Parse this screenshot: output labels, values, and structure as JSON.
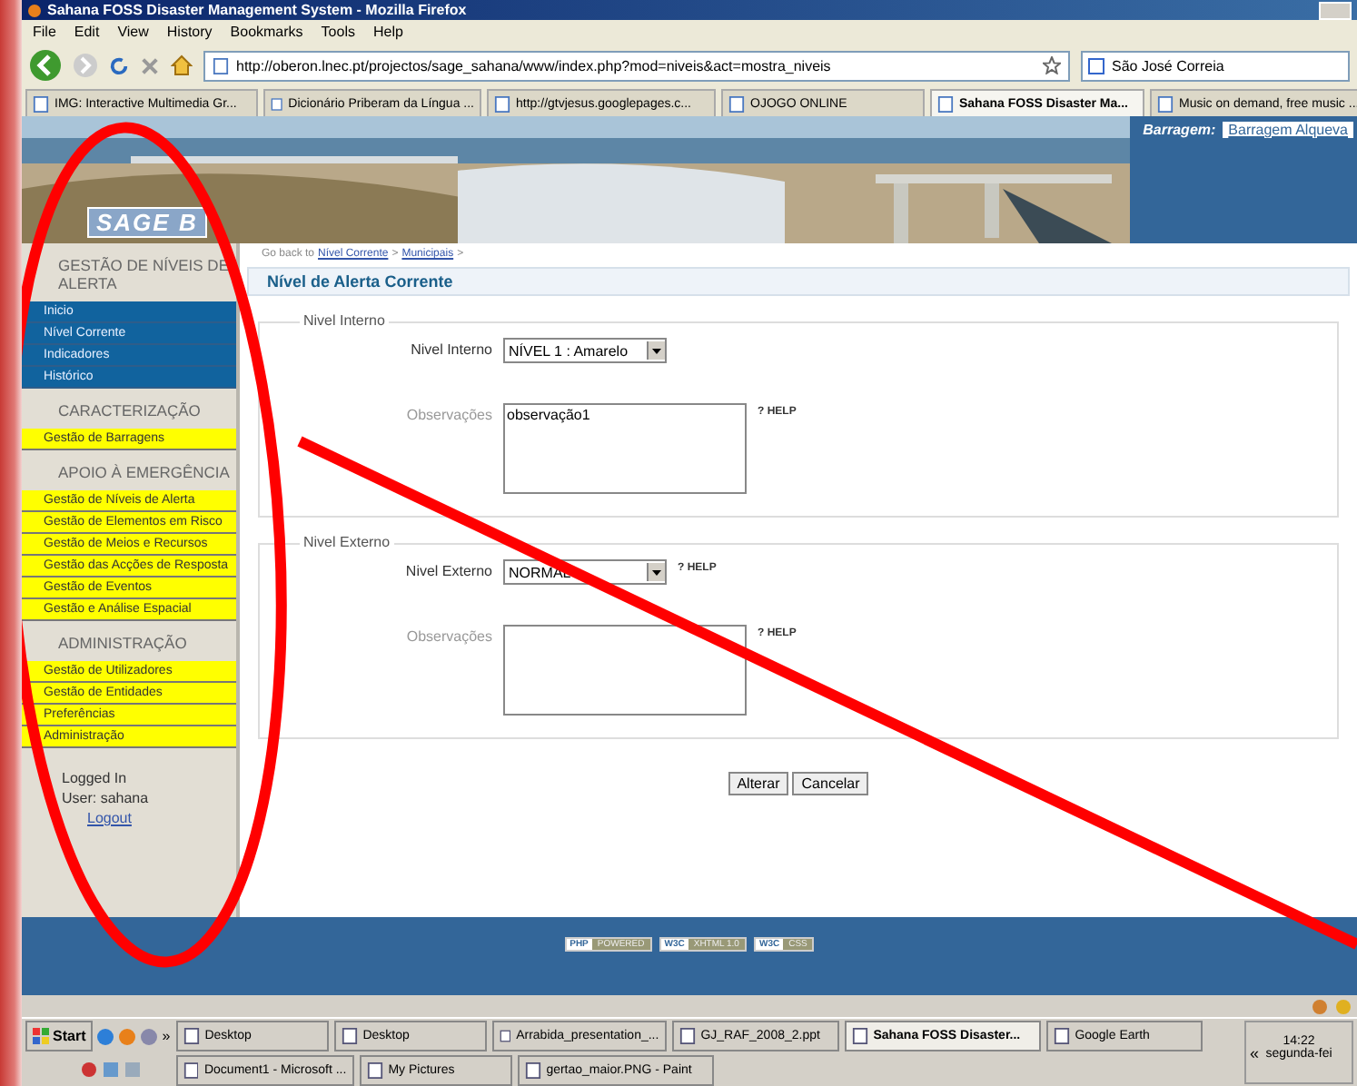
{
  "window": {
    "title": "Sahana FOSS Disaster Management System - Mozilla Firefox"
  },
  "menu": [
    "File",
    "Edit",
    "View",
    "History",
    "Bookmarks",
    "Tools",
    "Help"
  ],
  "nav": {
    "url": "http://oberon.lnec.pt/projectos/sage_sahana/www/index.php?mod=niveis&act=mostra_niveis",
    "search": "São José Correia"
  },
  "tabs": [
    {
      "label": "IMG: Interactive Multimedia Gr...",
      "selected": false
    },
    {
      "label": "Dicionário Priberam da Língua ...",
      "selected": false
    },
    {
      "label": "http://gtvjesus.googlepages.c...",
      "selected": false
    },
    {
      "label": "OJOGO ONLINE",
      "selected": false
    },
    {
      "label": "Sahana FOSS Disaster Ma...",
      "selected": true
    },
    {
      "label": "Music on demand, free music ...",
      "selected": false
    }
  ],
  "banner": {
    "logo": "SAGE B",
    "label": "Barragem:",
    "value": "Barragem Alqueva"
  },
  "sidebar": [
    {
      "title": "GESTÃO DE NÍVEIS DE ALERTA",
      "kind": "blue",
      "items": [
        "Inicio",
        "Nível Corrente",
        "Indicadores",
        "Histórico"
      ]
    },
    {
      "title": "CARACTERIZAÇÃO",
      "kind": "yellow",
      "items": [
        "Gestão de Barragens"
      ]
    },
    {
      "title": "APOIO À EMERGÊNCIA",
      "kind": "yellow",
      "items": [
        "Gestão de Níveis de Alerta",
        "Gestão de Elementos em Risco",
        "Gestão de Meios e Recursos",
        "Gestão das Acções de Resposta",
        "Gestão de Eventos",
        "Gestão e Análise Espacial"
      ]
    },
    {
      "title": "ADMINISTRAÇÃO",
      "kind": "yellow",
      "items": [
        "Gestão de Utilizadores",
        "Gestão de Entidades",
        "Preferências",
        "Administração"
      ]
    }
  ],
  "login": {
    "status": "Logged In",
    "user": "User: sahana",
    "logout": "Logout"
  },
  "breadcrumb": {
    "prefix": "Go back to",
    "separator": ">",
    "links": [
      "Nível Corrente",
      "Municipais"
    ]
  },
  "page_title": "Nível de Alerta Corrente",
  "fieldsets": [
    {
      "legend": "Nivel Interno",
      "fields": [
        {
          "kind": "select",
          "label": "Nivel Interno",
          "value": "NÍVEL 1 : Amarelo"
        },
        {
          "kind": "textarea",
          "label": "Observações",
          "value": "observação1",
          "help_mark": "?",
          "help": "HELP"
        }
      ]
    },
    {
      "legend": "Nivel Externo",
      "fields": [
        {
          "kind": "select",
          "label": "Nivel Externo",
          "value": "NORMAL",
          "help_mark": "?",
          "help": "HELP"
        },
        {
          "kind": "textarea",
          "label": "Observações",
          "help_mark": "?",
          "help": "HELP"
        }
      ]
    }
  ],
  "buttons": [
    "Alterar",
    "Cancelar"
  ],
  "footer_badges": [
    {
      "left": "PHP",
      "right": "POWERED"
    },
    {
      "left": "W3C",
      "right": "XHTML 1.0"
    },
    {
      "left": "W3C",
      "right": "CSS"
    }
  ],
  "taskbar": {
    "start": "Start",
    "more": "»",
    "rows": [
      [
        {
          "label": "Desktop",
          "selected": false
        },
        {
          "label": "Desktop",
          "selected": false
        },
        {
          "label": "Arrabida_presentation_...",
          "selected": false
        },
        {
          "label": "GJ_RAF_2008_2.ppt",
          "selected": false
        },
        {
          "label": "Sahana FOSS Disaster...",
          "selected": true
        },
        {
          "label": "Google Earth",
          "selected": false
        }
      ],
      [
        {
          "label": "Document1 - Microsoft ...",
          "selected": false
        },
        {
          "label": "My Pictures",
          "selected": false
        },
        {
          "label": "gertao_maior.PNG - Paint",
          "selected": false
        }
      ]
    ],
    "tray_expand": "«",
    "time": "14:22",
    "day": "segunda-fei"
  }
}
